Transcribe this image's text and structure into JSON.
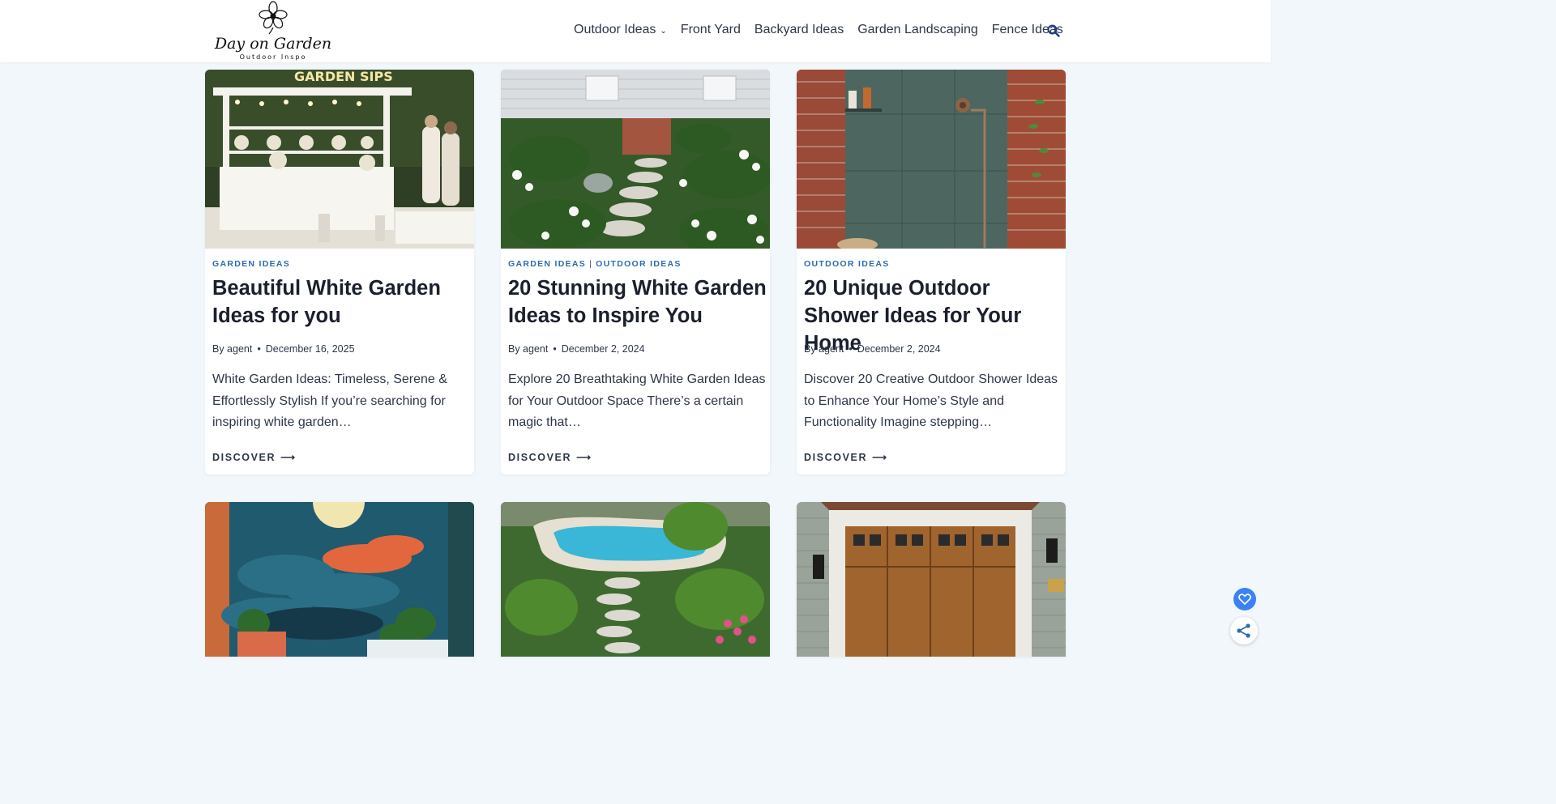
{
  "header": {
    "logo_text": "Day on Garden",
    "logo_tagline": "Outdoor Inspo",
    "nav": [
      {
        "label": "Outdoor Ideas",
        "has_dropdown": true
      },
      {
        "label": "Front Yard"
      },
      {
        "label": "Backyard Ideas"
      },
      {
        "label": "Garden Landscaping"
      },
      {
        "label": "Fence Ideas"
      }
    ],
    "search_icon": "search-icon"
  },
  "posts": [
    {
      "categories": [
        "Garden Ideas"
      ],
      "title": "Beautiful White Garden Ideas for you",
      "author": "By agent",
      "date": "December 16, 2025",
      "excerpt": "White Garden Ideas: Timeless, Serene & Effortlessly Stylish If you’re searching for inspiring white garden…",
      "more": "Discover",
      "image_sign": "GARDEN SIPS"
    },
    {
      "categories": [
        "Garden Ideas",
        "Outdoor Ideas"
      ],
      "title": "20 Stunning White Garden Ideas to Inspire You",
      "author": "By agent",
      "date": "December 2, 2024",
      "excerpt": "Explore 20 Breathtaking White Garden Ideas for Your Outdoor Space There’s a certain magic that…",
      "more": "Discover"
    },
    {
      "categories": [
        "Outdoor Ideas"
      ],
      "title": "20 Unique Outdoor Shower Ideas for Your Home",
      "author": "By agent",
      "date": "December 2, 2024",
      "excerpt": "Discover 20 Creative Outdoor Shower Ideas to Enhance Your Home’s Style and Functionality Imagine stepping…",
      "more": "Discover"
    }
  ],
  "arrow_glyph": "⟶",
  "dot_glyph": "•",
  "category_separator": "|",
  "colors": {
    "accent": "#2b6cb0",
    "background": "#f2f7fb",
    "fab": "#3b82f6"
  }
}
